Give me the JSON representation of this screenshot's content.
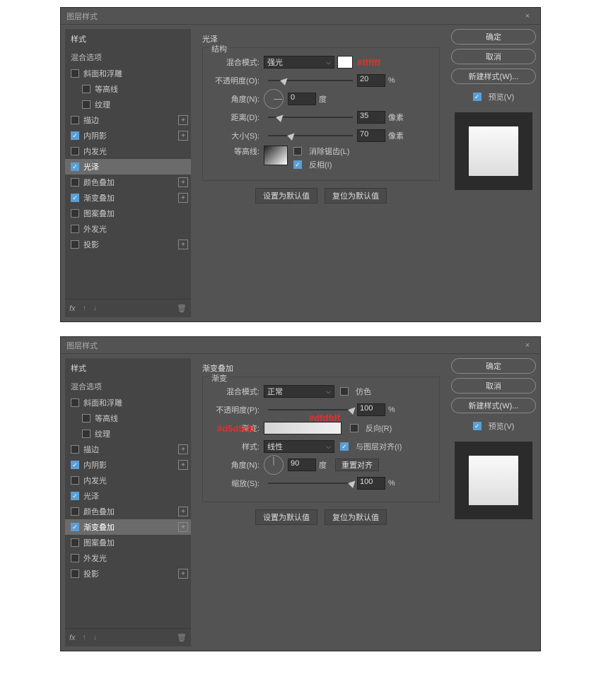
{
  "dialogs": [
    {
      "title": "图层样式",
      "sidebar": {
        "header": "样式",
        "blend": "混合选项",
        "items": [
          {
            "label": "斜面和浮雕",
            "checked": false,
            "plus": false,
            "indent": 0
          },
          {
            "label": "等高线",
            "checked": false,
            "plus": false,
            "indent": 1
          },
          {
            "label": "纹理",
            "checked": false,
            "plus": false,
            "indent": 1
          },
          {
            "label": "描边",
            "checked": false,
            "plus": true,
            "indent": 0
          },
          {
            "label": "内阴影",
            "checked": true,
            "plus": true,
            "indent": 0
          },
          {
            "label": "内发光",
            "checked": false,
            "plus": false,
            "indent": 0
          },
          {
            "label": "光泽",
            "checked": true,
            "plus": false,
            "indent": 0,
            "selected": true
          },
          {
            "label": "颜色叠加",
            "checked": false,
            "plus": true,
            "indent": 0
          },
          {
            "label": "渐变叠加",
            "checked": true,
            "plus": true,
            "indent": 0
          },
          {
            "label": "图案叠加",
            "checked": false,
            "plus": false,
            "indent": 0
          },
          {
            "label": "外发光",
            "checked": false,
            "plus": false,
            "indent": 0
          },
          {
            "label": "投影",
            "checked": false,
            "plus": true,
            "indent": 0
          }
        ],
        "fx": "fx"
      },
      "main": {
        "title": "光泽",
        "fieldset": "结构",
        "blend_mode_label": "混合模式:",
        "blend_mode_value": "强光",
        "color_annotation": "#ffffff",
        "opacity_label": "不透明度(O):",
        "opacity_value": "20",
        "opacity_unit": "%",
        "angle_label": "角度(N):",
        "angle_value": "0",
        "angle_unit": "度",
        "distance_label": "距离(D):",
        "distance_value": "35",
        "distance_unit": "像素",
        "size_label": "大小(S):",
        "size_value": "70",
        "size_unit": "像素",
        "contour_label": "等高线:",
        "anti_alias": "消除锯齿(L)",
        "invert": "反相(I)",
        "set_default": "设置为默认值",
        "reset_default": "复位为默认值"
      },
      "right": {
        "ok": "确定",
        "cancel": "取消",
        "new_style": "新建样式(W)...",
        "preview": "预览(V)"
      }
    },
    {
      "title": "图层样式",
      "sidebar": {
        "header": "样式",
        "blend": "混合选项",
        "items": [
          {
            "label": "斜面和浮雕",
            "checked": false,
            "plus": false,
            "indent": 0
          },
          {
            "label": "等高线",
            "checked": false,
            "plus": false,
            "indent": 1
          },
          {
            "label": "纹理",
            "checked": false,
            "plus": false,
            "indent": 1
          },
          {
            "label": "描边",
            "checked": false,
            "plus": true,
            "indent": 0
          },
          {
            "label": "内阴影",
            "checked": true,
            "plus": true,
            "indent": 0
          },
          {
            "label": "内发光",
            "checked": false,
            "plus": false,
            "indent": 0
          },
          {
            "label": "光泽",
            "checked": true,
            "plus": false,
            "indent": 0
          },
          {
            "label": "颜色叠加",
            "checked": false,
            "plus": true,
            "indent": 0
          },
          {
            "label": "渐变叠加",
            "checked": true,
            "plus": true,
            "indent": 0,
            "selected": true
          },
          {
            "label": "图案叠加",
            "checked": false,
            "plus": false,
            "indent": 0
          },
          {
            "label": "外发光",
            "checked": false,
            "plus": false,
            "indent": 0
          },
          {
            "label": "投影",
            "checked": false,
            "plus": true,
            "indent": 0
          }
        ],
        "fx": "fx"
      },
      "main": {
        "title": "渐变叠加",
        "fieldset": "渐变",
        "blend_mode_label": "混合模式:",
        "blend_mode_value": "正常",
        "dither": "仿色",
        "opacity_label": "不透明度(P):",
        "opacity_value": "100",
        "opacity_unit": "%",
        "left_annotation": "#d5d5d5",
        "right_annotation": "#dfdfdf",
        "gradient_label": "渐变:",
        "reverse": "反向(R)",
        "style_label": "样式:",
        "style_value": "线性",
        "align": "与图层对齐(I)",
        "angle_label": "角度(N):",
        "angle_value": "90",
        "angle_unit": "度",
        "reset_align": "重置对齐",
        "scale_label": "缩放(S):",
        "scale_value": "100",
        "scale_unit": "%",
        "set_default": "设置为默认值",
        "reset_default": "复位为默认值"
      },
      "right": {
        "ok": "确定",
        "cancel": "取消",
        "new_style": "新建样式(W)...",
        "preview": "预览(V)"
      }
    }
  ]
}
